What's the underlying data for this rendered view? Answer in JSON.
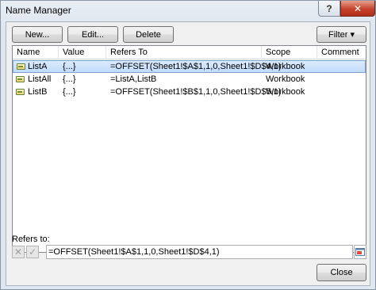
{
  "window": {
    "title": "Name Manager",
    "help_label": "?",
    "close_label": "✕"
  },
  "toolbar": {
    "new_label": "New...",
    "edit_label": "Edit...",
    "delete_label": "Delete",
    "filter_label": "Filter ▾"
  },
  "table": {
    "columns": [
      "Name",
      "Value",
      "Refers To",
      "Scope",
      "Comment"
    ],
    "rows": [
      {
        "name": "ListA",
        "value": "{...}",
        "refers_to": "=OFFSET(Sheet1!$A$1,1,0,Sheet1!$D$4,1)",
        "scope": "Workbook",
        "comment": "",
        "selected": true
      },
      {
        "name": "ListAll",
        "value": "{...}",
        "refers_to": "=ListA,ListB",
        "scope": "Workbook",
        "comment": "",
        "selected": false
      },
      {
        "name": "ListB",
        "value": "{...}",
        "refers_to": "=OFFSET(Sheet1!$B$1,1,0,Sheet1!$D$5,1)",
        "scope": "Workbook",
        "comment": "",
        "selected": false
      }
    ]
  },
  "refers_to": {
    "label": "Refers to:",
    "cancel_icon": "✕",
    "confirm_icon": "✓",
    "value": "=OFFSET(Sheet1!$A$1,1,0,Sheet1!$D$4,1)"
  },
  "footer": {
    "close_label": "Close"
  },
  "colors": {
    "selection": "#c1dbfc",
    "close_button": "#c4422b"
  }
}
